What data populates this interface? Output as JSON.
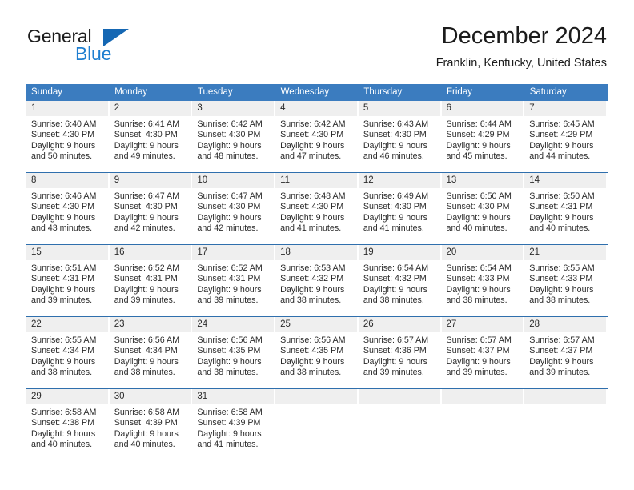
{
  "logo": {
    "word_one": "General",
    "word_two": "Blue",
    "triangle_icon": "blue-triangle-icon",
    "brand_blue": "#1f7fd0",
    "triangle_color": "#1567b3"
  },
  "header": {
    "title": "December 2024",
    "location": "Franklin, Kentucky, United States"
  },
  "calendar": {
    "header_color": "#3b7cbf",
    "daynum_bg": "#efefef",
    "row_divider_color": "#2f6fad",
    "weekday_headers": [
      "Sunday",
      "Monday",
      "Tuesday",
      "Wednesday",
      "Thursday",
      "Friday",
      "Saturday"
    ],
    "weeks": [
      [
        {
          "day": "1",
          "sunrise": "Sunrise: 6:40 AM",
          "sunset": "Sunset: 4:30 PM",
          "daylight_line1": "Daylight: 9 hours",
          "daylight_line2": "and 50 minutes."
        },
        {
          "day": "2",
          "sunrise": "Sunrise: 6:41 AM",
          "sunset": "Sunset: 4:30 PM",
          "daylight_line1": "Daylight: 9 hours",
          "daylight_line2": "and 49 minutes."
        },
        {
          "day": "3",
          "sunrise": "Sunrise: 6:42 AM",
          "sunset": "Sunset: 4:30 PM",
          "daylight_line1": "Daylight: 9 hours",
          "daylight_line2": "and 48 minutes."
        },
        {
          "day": "4",
          "sunrise": "Sunrise: 6:42 AM",
          "sunset": "Sunset: 4:30 PM",
          "daylight_line1": "Daylight: 9 hours",
          "daylight_line2": "and 47 minutes."
        },
        {
          "day": "5",
          "sunrise": "Sunrise: 6:43 AM",
          "sunset": "Sunset: 4:30 PM",
          "daylight_line1": "Daylight: 9 hours",
          "daylight_line2": "and 46 minutes."
        },
        {
          "day": "6",
          "sunrise": "Sunrise: 6:44 AM",
          "sunset": "Sunset: 4:29 PM",
          "daylight_line1": "Daylight: 9 hours",
          "daylight_line2": "and 45 minutes."
        },
        {
          "day": "7",
          "sunrise": "Sunrise: 6:45 AM",
          "sunset": "Sunset: 4:29 PM",
          "daylight_line1": "Daylight: 9 hours",
          "daylight_line2": "and 44 minutes."
        }
      ],
      [
        {
          "day": "8",
          "sunrise": "Sunrise: 6:46 AM",
          "sunset": "Sunset: 4:30 PM",
          "daylight_line1": "Daylight: 9 hours",
          "daylight_line2": "and 43 minutes."
        },
        {
          "day": "9",
          "sunrise": "Sunrise: 6:47 AM",
          "sunset": "Sunset: 4:30 PM",
          "daylight_line1": "Daylight: 9 hours",
          "daylight_line2": "and 42 minutes."
        },
        {
          "day": "10",
          "sunrise": "Sunrise: 6:47 AM",
          "sunset": "Sunset: 4:30 PM",
          "daylight_line1": "Daylight: 9 hours",
          "daylight_line2": "and 42 minutes."
        },
        {
          "day": "11",
          "sunrise": "Sunrise: 6:48 AM",
          "sunset": "Sunset: 4:30 PM",
          "daylight_line1": "Daylight: 9 hours",
          "daylight_line2": "and 41 minutes."
        },
        {
          "day": "12",
          "sunrise": "Sunrise: 6:49 AM",
          "sunset": "Sunset: 4:30 PM",
          "daylight_line1": "Daylight: 9 hours",
          "daylight_line2": "and 41 minutes."
        },
        {
          "day": "13",
          "sunrise": "Sunrise: 6:50 AM",
          "sunset": "Sunset: 4:30 PM",
          "daylight_line1": "Daylight: 9 hours",
          "daylight_line2": "and 40 minutes."
        },
        {
          "day": "14",
          "sunrise": "Sunrise: 6:50 AM",
          "sunset": "Sunset: 4:31 PM",
          "daylight_line1": "Daylight: 9 hours",
          "daylight_line2": "and 40 minutes."
        }
      ],
      [
        {
          "day": "15",
          "sunrise": "Sunrise: 6:51 AM",
          "sunset": "Sunset: 4:31 PM",
          "daylight_line1": "Daylight: 9 hours",
          "daylight_line2": "and 39 minutes."
        },
        {
          "day": "16",
          "sunrise": "Sunrise: 6:52 AM",
          "sunset": "Sunset: 4:31 PM",
          "daylight_line1": "Daylight: 9 hours",
          "daylight_line2": "and 39 minutes."
        },
        {
          "day": "17",
          "sunrise": "Sunrise: 6:52 AM",
          "sunset": "Sunset: 4:31 PM",
          "daylight_line1": "Daylight: 9 hours",
          "daylight_line2": "and 39 minutes."
        },
        {
          "day": "18",
          "sunrise": "Sunrise: 6:53 AM",
          "sunset": "Sunset: 4:32 PM",
          "daylight_line1": "Daylight: 9 hours",
          "daylight_line2": "and 38 minutes."
        },
        {
          "day": "19",
          "sunrise": "Sunrise: 6:54 AM",
          "sunset": "Sunset: 4:32 PM",
          "daylight_line1": "Daylight: 9 hours",
          "daylight_line2": "and 38 minutes."
        },
        {
          "day": "20",
          "sunrise": "Sunrise: 6:54 AM",
          "sunset": "Sunset: 4:33 PM",
          "daylight_line1": "Daylight: 9 hours",
          "daylight_line2": "and 38 minutes."
        },
        {
          "day": "21",
          "sunrise": "Sunrise: 6:55 AM",
          "sunset": "Sunset: 4:33 PM",
          "daylight_line1": "Daylight: 9 hours",
          "daylight_line2": "and 38 minutes."
        }
      ],
      [
        {
          "day": "22",
          "sunrise": "Sunrise: 6:55 AM",
          "sunset": "Sunset: 4:34 PM",
          "daylight_line1": "Daylight: 9 hours",
          "daylight_line2": "and 38 minutes."
        },
        {
          "day": "23",
          "sunrise": "Sunrise: 6:56 AM",
          "sunset": "Sunset: 4:34 PM",
          "daylight_line1": "Daylight: 9 hours",
          "daylight_line2": "and 38 minutes."
        },
        {
          "day": "24",
          "sunrise": "Sunrise: 6:56 AM",
          "sunset": "Sunset: 4:35 PM",
          "daylight_line1": "Daylight: 9 hours",
          "daylight_line2": "and 38 minutes."
        },
        {
          "day": "25",
          "sunrise": "Sunrise: 6:56 AM",
          "sunset": "Sunset: 4:35 PM",
          "daylight_line1": "Daylight: 9 hours",
          "daylight_line2": "and 38 minutes."
        },
        {
          "day": "26",
          "sunrise": "Sunrise: 6:57 AM",
          "sunset": "Sunset: 4:36 PM",
          "daylight_line1": "Daylight: 9 hours",
          "daylight_line2": "and 39 minutes."
        },
        {
          "day": "27",
          "sunrise": "Sunrise: 6:57 AM",
          "sunset": "Sunset: 4:37 PM",
          "daylight_line1": "Daylight: 9 hours",
          "daylight_line2": "and 39 minutes."
        },
        {
          "day": "28",
          "sunrise": "Sunrise: 6:57 AM",
          "sunset": "Sunset: 4:37 PM",
          "daylight_line1": "Daylight: 9 hours",
          "daylight_line2": "and 39 minutes."
        }
      ],
      [
        {
          "day": "29",
          "sunrise": "Sunrise: 6:58 AM",
          "sunset": "Sunset: 4:38 PM",
          "daylight_line1": "Daylight: 9 hours",
          "daylight_line2": "and 40 minutes."
        },
        {
          "day": "30",
          "sunrise": "Sunrise: 6:58 AM",
          "sunset": "Sunset: 4:39 PM",
          "daylight_line1": "Daylight: 9 hours",
          "daylight_line2": "and 40 minutes."
        },
        {
          "day": "31",
          "sunrise": "Sunrise: 6:58 AM",
          "sunset": "Sunset: 4:39 PM",
          "daylight_line1": "Daylight: 9 hours",
          "daylight_line2": "and 41 minutes."
        },
        {
          "day": "",
          "sunrise": "",
          "sunset": "",
          "daylight_line1": "",
          "daylight_line2": ""
        },
        {
          "day": "",
          "sunrise": "",
          "sunset": "",
          "daylight_line1": "",
          "daylight_line2": ""
        },
        {
          "day": "",
          "sunrise": "",
          "sunset": "",
          "daylight_line1": "",
          "daylight_line2": ""
        },
        {
          "day": "",
          "sunrise": "",
          "sunset": "",
          "daylight_line1": "",
          "daylight_line2": ""
        }
      ]
    ]
  }
}
